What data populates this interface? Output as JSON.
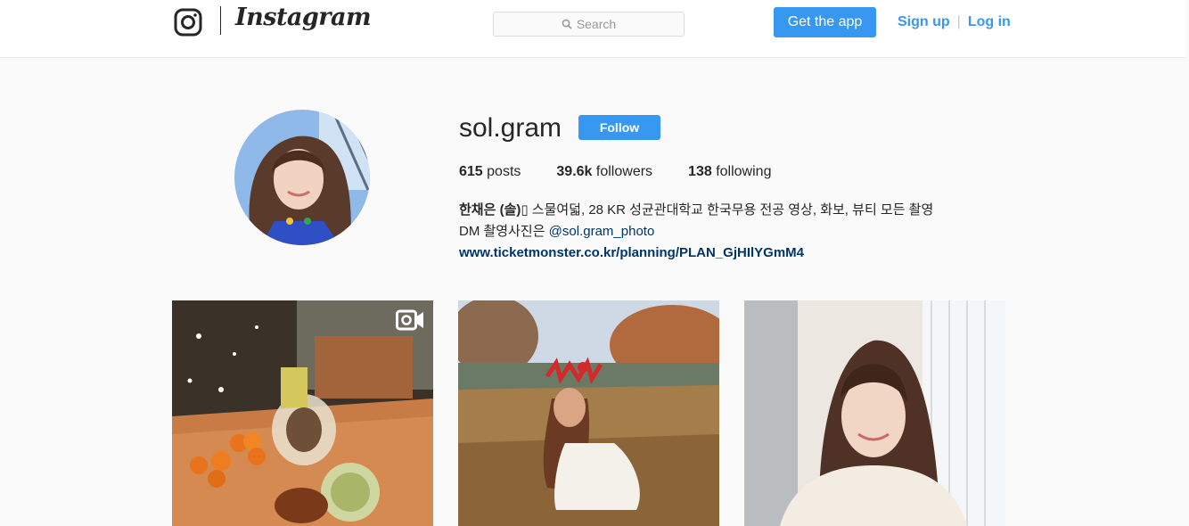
{
  "header": {
    "logo_text": "Instagram",
    "search_placeholder": "Search",
    "get_app_label": "Get the app",
    "signup_label": "Sign up",
    "separator": "|",
    "login_label": "Log in"
  },
  "profile": {
    "username": "sol.gram",
    "follow_label": "Follow",
    "posts_count": "615",
    "posts_label": "posts",
    "followers_count": "39.6k",
    "followers_label": "followers",
    "following_count": "138",
    "following_label": "following",
    "bio_name": "한채은 (솔)",
    "bio_line1_rest": "▯ 스물여덟, 28 KR 성균관대학교 한국무용 전공 영상, 화보, 뷰티 모든 촬영",
    "bio_line2_prefix": "DM 촬영사진은 ",
    "bio_mention": "@sol.gram_photo",
    "bio_url": "www.ticketmonster.co.kr/planning/PLAN_GjHIlYGmM4"
  },
  "posts": [
    {
      "type": "video",
      "icon": "video-camera-icon"
    },
    {
      "type": "photo"
    },
    {
      "type": "photo"
    }
  ],
  "colors": {
    "accent": "#3897f0",
    "link_dark": "#003569",
    "text": "#262626",
    "background": "#fafafa"
  }
}
